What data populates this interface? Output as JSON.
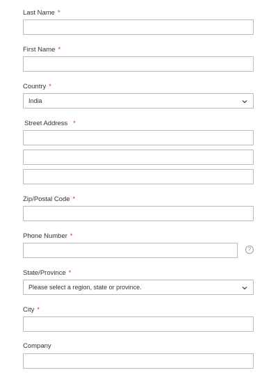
{
  "form": {
    "last_name_label": "Last Name",
    "first_name_label": "First Name",
    "country_label": "Country",
    "country_value": "India",
    "street_label": "Street Address",
    "zip_label": "Zip/Postal Code",
    "phone_label": "Phone Number",
    "phone_help": "?",
    "state_label": "State/Province",
    "state_value": "Please select a region, state or province.",
    "city_label": "City",
    "company_label": "Company",
    "required_mark": "*"
  },
  "icons": {
    "select_arrow": "chevron-down-icon",
    "help": "help-icon"
  },
  "colors": {
    "required": "#e02b27",
    "border": "#b9b9b9"
  }
}
